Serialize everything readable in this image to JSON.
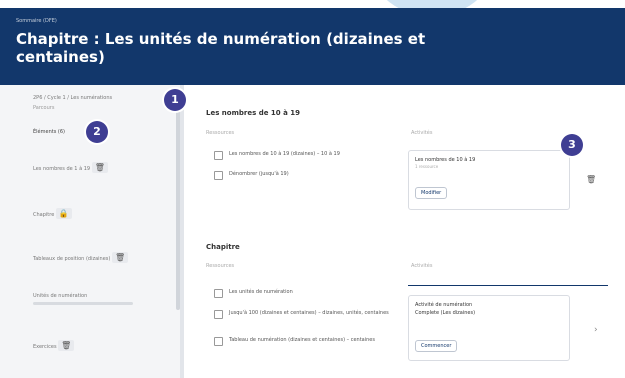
{
  "header": {
    "kicker": "Sommaire (DFE)",
    "title": "Chapitre : Les unités de numération (dizaines et centaines)"
  },
  "sidebar": {
    "crumb": "2P6 / Cycle 1 / Les  numérations",
    "sub": "Parcours",
    "section_label": "Éléments  (6)",
    "items": [
      {
        "label": "Les nombres de 1 à 19"
      },
      {
        "label": "Chapitre"
      },
      {
        "label": "Tableaux de position (dizaines)"
      },
      {
        "label": "Unités de numération"
      },
      {
        "label": "Exercices"
      }
    ]
  },
  "main": {
    "section1": {
      "title": "Les nombres de 10 à 19",
      "col1": "Ressources",
      "col2": "Activités",
      "rows": [
        {
          "text": "Les nombres de 10 à 19 (dizaines) – 10 à 19"
        },
        {
          "text": "Dénombrer (jusqu'à 19)"
        }
      ],
      "card": {
        "title": "Les nombres de 10 à 19",
        "sub": "1 ressource",
        "button": "Modifier"
      }
    },
    "section2": {
      "title": "Chapitre",
      "col1": "Ressources",
      "col2": "Activités",
      "rows": [
        {
          "text": "Les unités de numération"
        },
        {
          "text": "Jusqu'à 100 (dizaines et centaines) – dizaines, unités, centaines"
        },
        {
          "text": "Tableau de numération (dizaines et centaines) – centaines"
        }
      ],
      "card": {
        "title": "Activité de numération",
        "sub": "Complete (Les dizaines)",
        "button": "Commencer"
      }
    }
  },
  "markers": [
    "1",
    "2",
    "3"
  ]
}
